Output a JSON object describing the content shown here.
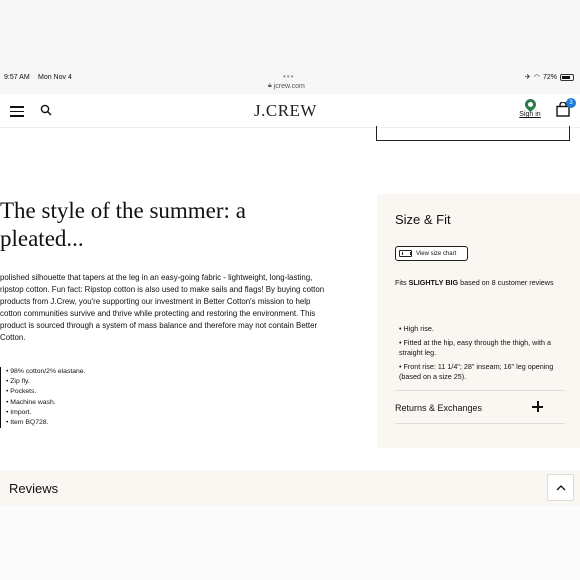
{
  "status_bar": {
    "time": "9:57 AM",
    "date": "Mon Nov 4",
    "url": "jcrew.com",
    "battery": "72%"
  },
  "header": {
    "logo": "J.CREW",
    "sign_in": "Sign in",
    "bag_count": "3"
  },
  "product": {
    "headline": "The style of the summer: a pleated...",
    "description": "polished silhouette that tapers at the leg in an easy-going fabric - lightweight, long-lasting, ripstop cotton. Fun fact: Ripstop cotton is also used to make sails and flags! By buying cotton products from J.Crew, you're supporting our investment in Better Cotton's mission to help cotton communities survive and thrive while protecting and restoring the environment. This product is sourced through a system of mass balance and therefore may not contain Better Cotton.",
    "details": [
      "98% cotton/2% elastane.",
      "Zip fly.",
      "Pockets.",
      "Machine wash.",
      "Import.",
      "Item BQ728."
    ]
  },
  "size_fit": {
    "title": "Size & Fit",
    "size_chart_button": "View size chart",
    "fit_prefix": "Fits ",
    "fit_value": "SLIGHTLY BIG",
    "fit_suffix": " based on 8 customer reviews",
    "fit_notes": [
      "High rise.",
      "Fitted at the hip, easy through the thigh, with a straight leg.",
      "Front rise: 11 1/4\"; 28\" inseam; 16\" leg opening (based on a size 25)."
    ],
    "returns_label": "Returns & Exchanges"
  },
  "reviews": {
    "title": "Reviews"
  },
  "colors": {
    "panel_bg": "#faf6f2",
    "badge": "#1e7bd6",
    "pin": "#2d7a4a"
  }
}
